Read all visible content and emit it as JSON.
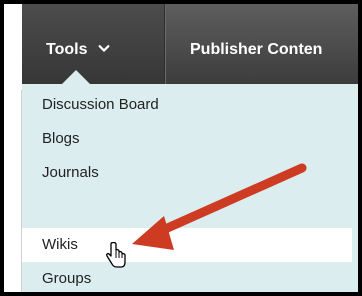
{
  "nav": {
    "tools_label": "Tools",
    "publisher_label": "Publisher Conten"
  },
  "menu": {
    "items": [
      {
        "label": "Discussion Board"
      },
      {
        "label": "Blogs"
      },
      {
        "label": "Journals"
      },
      {
        "label": "Wikis"
      },
      {
        "label": "Groups"
      }
    ],
    "highlighted": "Wikis"
  },
  "colors": {
    "nav_bg": "#4a4a4a",
    "dropdown_bg": "#dcedf0",
    "highlight_bg": "#ffffff",
    "arrow": "#cc3b22"
  }
}
